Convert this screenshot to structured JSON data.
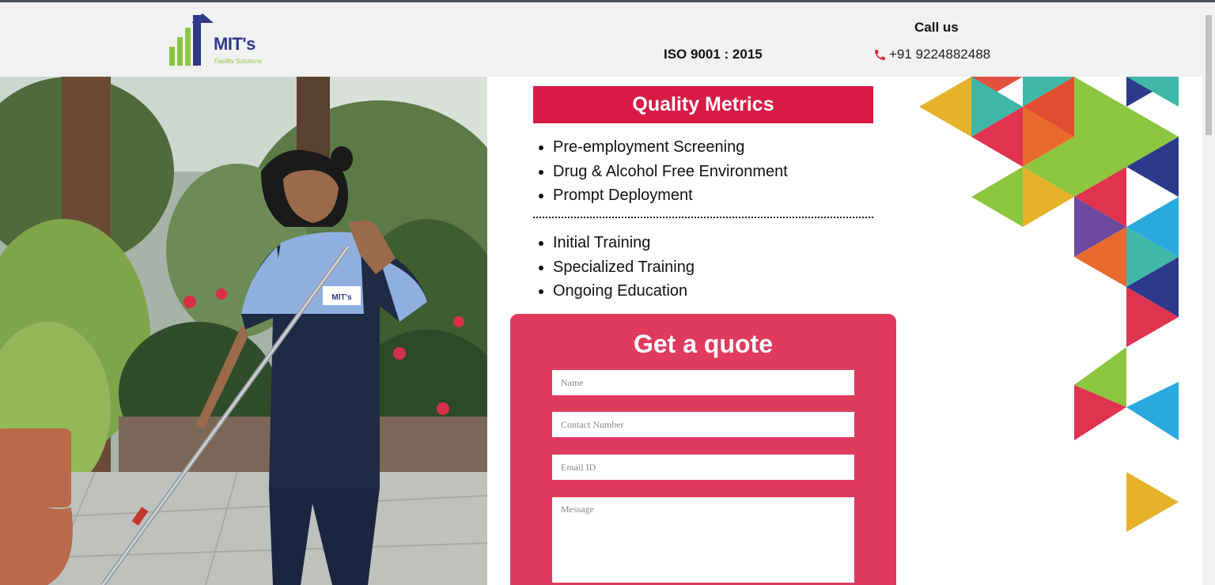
{
  "header": {
    "logo": {
      "name": "MIT's",
      "tagline": "Facility Solutions"
    },
    "iso": "ISO 9001 : 2015",
    "call_us": "Call us",
    "phone": "+91 9224882488"
  },
  "quality_metrics": {
    "title": "Quality Metrics",
    "list1": [
      "Pre-employment Screening",
      "Drug & Alcohol Free Environment",
      "Prompt Deployment"
    ],
    "list2": [
      "Initial Training",
      "Specialized Training",
      "Ongoing Education"
    ]
  },
  "quote_form": {
    "title": "Get a quote",
    "name_placeholder": "Name",
    "contact_placeholder": "Contact Number",
    "email_placeholder": "Email ID",
    "message_placeholder": "Message"
  },
  "photo": {
    "badge_text": "MIT's"
  },
  "colors": {
    "header_bg": "#f1f1f1",
    "banner_red": "#d81b46",
    "form_pink": "#e03a5e",
    "logo_blue": "#2d3a8c",
    "logo_green": "#8cc63f",
    "phone_icon": "#e0222b"
  }
}
